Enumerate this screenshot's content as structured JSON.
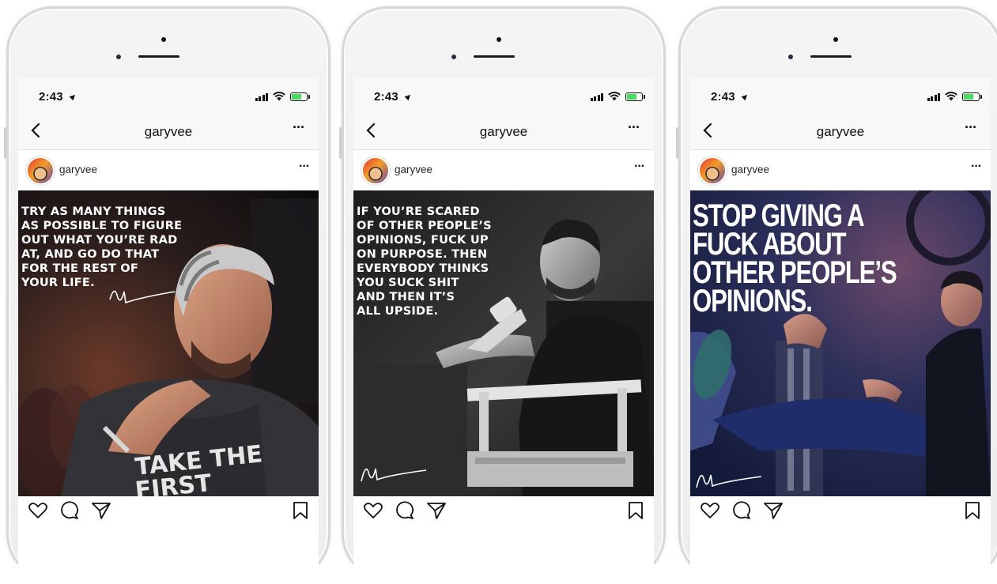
{
  "posts": [
    {
      "status_time": "2:43",
      "nav_title": "garyvee",
      "username": "garyvee",
      "caption": "TRY AS MANY THINGS\nAS POSSIBLE TO FIGURE\nOUT WHAT YOU’RE RAD\nAT, AND GO DO THAT\nFOR THE REST OF\nYOUR LIFE."
    },
    {
      "status_time": "2:43",
      "nav_title": "garyvee",
      "username": "garyvee",
      "caption": "IF YOU’RE SCARED\nOF OTHER PEOPLE’S\nOPINIONS, FUCK UP\nON PURPOSE. THEN\nEVERYBODY THINKS\nYOU SUCK SHIT\nAND THEN IT’S\nALL UPSIDE."
    },
    {
      "status_time": "2:43",
      "nav_title": "garyvee",
      "username": "garyvee",
      "caption": "STOP GIVING A\nFUCK ABOUT\nOTHER PEOPLE’S\nOPINIONS."
    }
  ],
  "icons": {
    "location_arrow": "location-arrow-icon",
    "signal": "cellular-signal-icon",
    "wifi": "wifi-icon",
    "battery": "battery-charging-icon",
    "back": "chevron-left-icon",
    "more": "more-horizontal-icon",
    "like": "heart-icon",
    "comment": "comment-icon",
    "share": "paper-plane-icon",
    "save": "bookmark-icon"
  },
  "colors": {
    "battery_fill": "#4cd964",
    "bar_background": "#f8f8f8",
    "text": "#262626"
  }
}
